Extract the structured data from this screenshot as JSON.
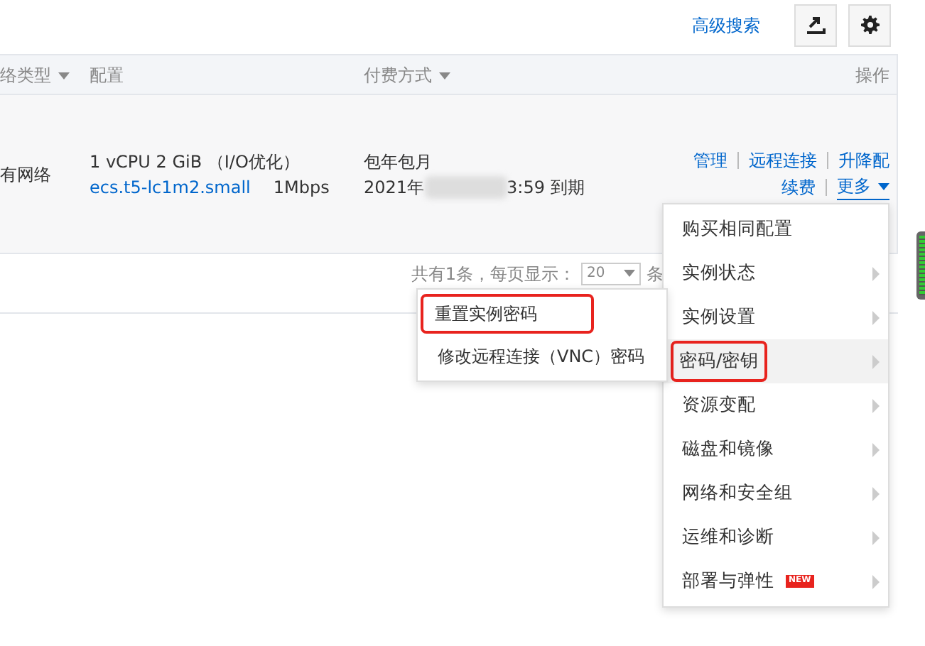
{
  "toolbar": {
    "advanced_search": "高级搜索"
  },
  "table": {
    "columns": [
      {
        "label": "络类型",
        "sortable": true
      },
      {
        "label": "配置",
        "sortable": false
      },
      {
        "label": "付费方式",
        "sortable": true
      },
      {
        "label": "操作",
        "sortable": false
      }
    ],
    "rows": [
      {
        "network": "有网络",
        "config": "1 vCPU 2 GiB （I/O优化）",
        "instance_type": "ecs.t5-lc1m2.small",
        "bandwidth": "1Mbps",
        "billing": "包年包月",
        "expiry_start": "2021年",
        "expiry_end": "3:59 到期",
        "actions": [
          {
            "label": "管理",
            "kind": "link"
          },
          {
            "label": "远程连接",
            "kind": "link"
          },
          {
            "label": "升降配",
            "kind": "link"
          },
          {
            "label": "续费",
            "kind": "link"
          },
          {
            "label": "更多",
            "kind": "dropdown"
          }
        ]
      }
    ]
  },
  "pagination": {
    "total": "共有1条，每页显示：",
    "page_size": "20",
    "unit": "条"
  },
  "menu": {
    "items": [
      {
        "label": "购买相同配置",
        "has_submenu": false,
        "hovered": false,
        "highlighted": false
      },
      {
        "label": "实例状态",
        "has_submenu": true,
        "hovered": false,
        "highlighted": false
      },
      {
        "label": "实例设置",
        "has_submenu": true,
        "hovered": false,
        "highlighted": false
      },
      {
        "label": "密码/密钥",
        "has_submenu": true,
        "hovered": true,
        "highlighted": true
      },
      {
        "label": "资源变配",
        "has_submenu": true,
        "hovered": false,
        "highlighted": false
      },
      {
        "label": "磁盘和镜像",
        "has_submenu": true,
        "hovered": false,
        "highlighted": false
      },
      {
        "label": "网络和安全组",
        "has_submenu": true,
        "hovered": false,
        "highlighted": false
      },
      {
        "label": "运维和诊断",
        "has_submenu": true,
        "hovered": false,
        "highlighted": false
      },
      {
        "label": "部署与弹性",
        "has_submenu": true,
        "hovered": false,
        "highlighted": false,
        "badge": "NEW"
      }
    ],
    "submenu": {
      "items": [
        {
          "label": "重置实例密码",
          "highlighted": true
        },
        {
          "label": "修改远程连接（VNC）密码",
          "highlighted": false
        }
      ]
    }
  }
}
